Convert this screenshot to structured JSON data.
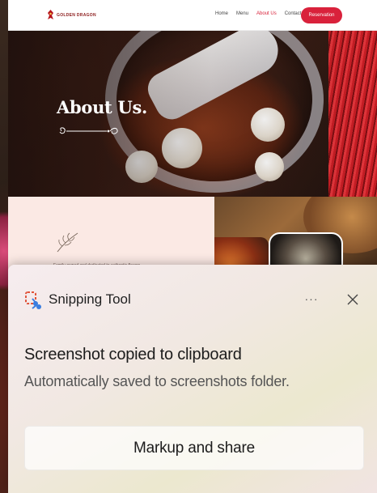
{
  "website": {
    "brand": "GOLDEN DRAGON",
    "nav": [
      {
        "label": "Home",
        "active": false
      },
      {
        "label": "Menu",
        "active": false
      },
      {
        "label": "About Us",
        "active": true
      },
      {
        "label": "Contact",
        "active": false
      }
    ],
    "cta_label": "Reservation",
    "hero_title": "About Us.",
    "about_blurb": "Family-owned and dedicated to authentic flavors.",
    "colors": {
      "accent": "#d9213b",
      "hero_title": "#ffffff",
      "panel": "#fbe9e4"
    }
  },
  "notification": {
    "app_name": "Snipping Tool",
    "app_icon": "snipping-tool-icon",
    "more_label": "···",
    "close_icon": "close-icon",
    "title": "Screenshot copied to clipboard",
    "body": "Automatically saved to screenshots folder.",
    "action_label": "Markup and share"
  }
}
